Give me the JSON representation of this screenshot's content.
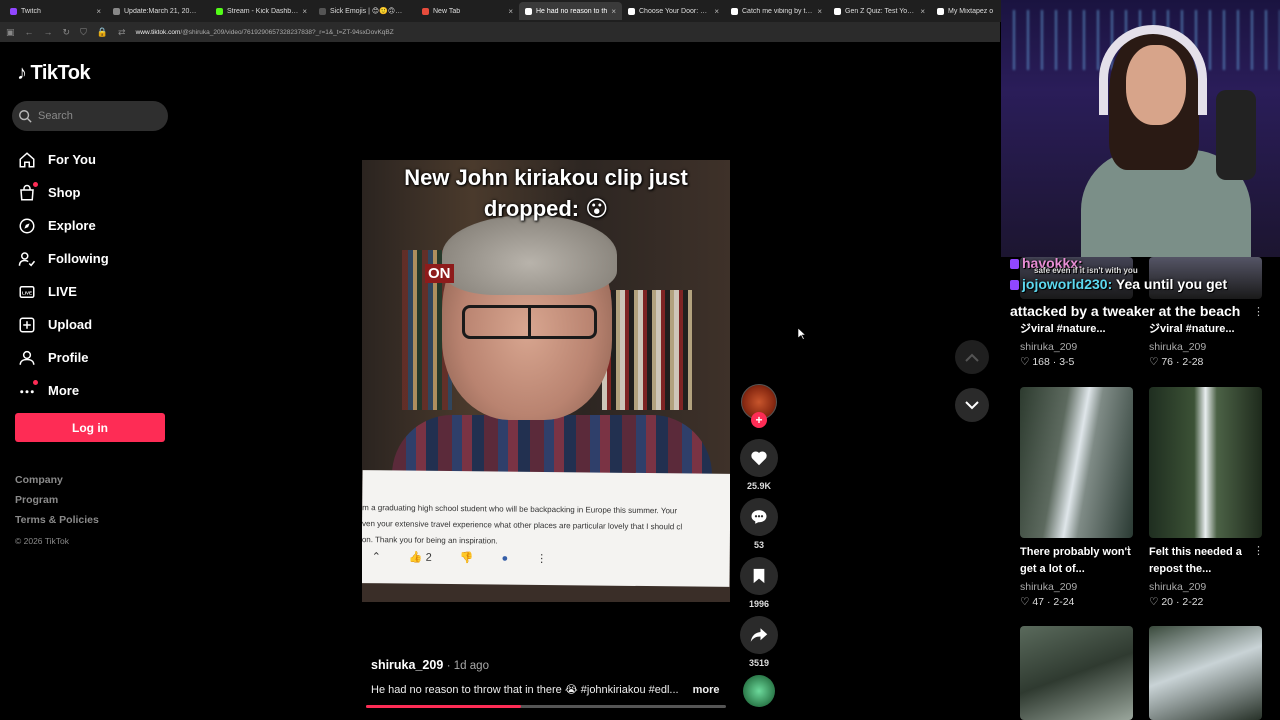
{
  "browser": {
    "tabs": [
      {
        "label": "Twitch",
        "color": "#9146ff",
        "active": false,
        "close": "×"
      },
      {
        "label": "Update:March 21, 2026 - Tr",
        "color": "#888",
        "active": false,
        "close": ""
      },
      {
        "label": "Stream - Kick Dashboard",
        "color": "#53fc18",
        "active": false,
        "close": "×"
      },
      {
        "label": "Sick Emojis | 😊🙂🙃🙂 | 🙂",
        "color": "#555",
        "active": false,
        "close": ""
      },
      {
        "label": "New Tab",
        "color": "#e74c3c",
        "active": false,
        "close": "×"
      },
      {
        "label": "He had no reason to th",
        "color": "#fff",
        "active": true,
        "close": "×"
      },
      {
        "label": "Choose Your Door: 24-Hour",
        "color": "#fff",
        "active": false,
        "close": "×"
      },
      {
        "label": "Catch me vibing by the sun",
        "color": "#fff",
        "active": false,
        "close": "×"
      },
      {
        "label": "Gen Z Quiz: Test Your Slang",
        "color": "#fff",
        "active": false,
        "close": "×"
      },
      {
        "label": "My Mixtapez o",
        "color": "#fff",
        "active": false,
        "close": ""
      }
    ],
    "url_domain": "www.tiktok.com",
    "url_path": "/@shiruka_209/video/7619290657328237838?_r=1&_t=ZT-94sxDovKqBZ"
  },
  "sidebar": {
    "logo": "TikTok",
    "search_placeholder": "Search",
    "items": [
      {
        "label": "For You",
        "icon": "home-icon",
        "dot": false
      },
      {
        "label": "Shop",
        "icon": "shop-icon",
        "dot": true
      },
      {
        "label": "Explore",
        "icon": "compass-icon",
        "dot": false
      },
      {
        "label": "Following",
        "icon": "following-icon",
        "dot": false
      },
      {
        "label": "LIVE",
        "icon": "live-icon",
        "dot": false
      },
      {
        "label": "Upload",
        "icon": "upload-icon",
        "dot": false
      },
      {
        "label": "Profile",
        "icon": "profile-icon",
        "dot": false
      },
      {
        "label": "More",
        "icon": "more-icon",
        "dot": true
      }
    ],
    "login_label": "Log in",
    "footer_links": [
      "Company",
      "Program",
      "Terms & Policies"
    ],
    "copyright": "© 2026 TikTok"
  },
  "video": {
    "overlay_title": "New John kiriakou clip just dropped: 😮",
    "on_air": "ON",
    "comment_text": [
      "m a graduating high school student who will be backpacking in Europe this summer. Your",
      "ven your extensive travel experience what other places are particular lovely that I should cl",
      "on. Thank you for being an inspiration."
    ],
    "comment_likes": "2",
    "author": "shiruka_209",
    "posted": "· 1d ago",
    "description": "He had no reason to throw that in there 😭 #johnkiriakou #edl...",
    "more_label": "more",
    "progress": 0.43
  },
  "actions": {
    "likes": "25.9K",
    "comments": "53",
    "saves": "1996",
    "shares": "3519",
    "follow_symbol": "+"
  },
  "chat": [
    {
      "user": "havokkx:",
      "message": "",
      "color": "#e98ed6"
    },
    {
      "user": "jojoworld230:",
      "message": "Yea until you get attacked by a tweaker at the beach",
      "color": "#5dd9f0"
    }
  ],
  "chat_fragment": "safe even if it isn't with you",
  "grid": [
    {
      "caption": "ジviral #nature...",
      "user": "shiruka_209",
      "likes": "168",
      "date": "3-5"
    },
    {
      "caption": "ジviral #nature...",
      "user": "shiruka_209",
      "likes": "76",
      "date": "2-28"
    },
    {
      "caption": "There probably won't get a lot of...",
      "user": "shiruka_209",
      "likes": "47",
      "date": "2-24"
    },
    {
      "caption": "Felt this needed a repost the...",
      "user": "shiruka_209",
      "likes": "20",
      "date": "2-22"
    }
  ]
}
